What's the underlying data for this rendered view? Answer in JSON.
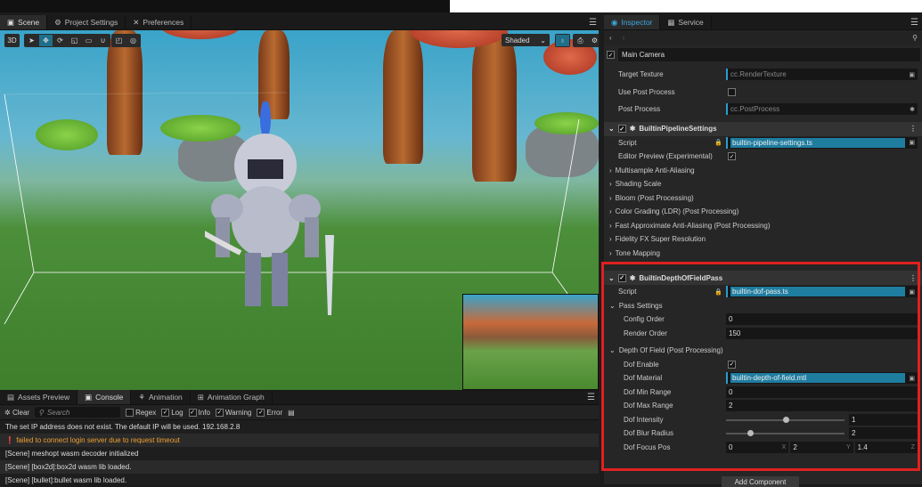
{
  "left_tabs": [
    {
      "label": "Scene",
      "icon": "scene-icon"
    },
    {
      "label": "Project Settings",
      "icon": "gear-icon"
    },
    {
      "label": "Preferences",
      "icon": "tools-icon"
    }
  ],
  "viewport": {
    "mode_3d": "3D",
    "shading": "Shaded"
  },
  "bottom_tabs": [
    {
      "label": "Assets Preview"
    },
    {
      "label": "Console"
    },
    {
      "label": "Animation"
    },
    {
      "label": "Animation Graph"
    }
  ],
  "console": {
    "clear": "Clear",
    "search_placeholder": "Search",
    "filters": [
      {
        "label": "Regex",
        "checked": false
      },
      {
        "label": "Log",
        "checked": true
      },
      {
        "label": "Info",
        "checked": true
      },
      {
        "label": "Warning",
        "checked": true
      },
      {
        "label": "Error",
        "checked": true
      }
    ],
    "logs": [
      {
        "text": "The set IP address does not exist. The default IP will be used. 192.168.2.8",
        "type": "log"
      },
      {
        "text": "failed to connect login server due to request timeout",
        "type": "warn"
      },
      {
        "text": "[Scene] meshopt wasm decoder initialized",
        "type": "log"
      },
      {
        "text": "[Scene] [box2d]:box2d wasm lib loaded.",
        "type": "log"
      },
      {
        "text": "[Scene] [bullet]:bullet wasm lib loaded.",
        "type": "log"
      }
    ]
  },
  "right_tabs": [
    {
      "label": "Inspector"
    },
    {
      "label": "Service"
    }
  ],
  "inspector": {
    "node": "Main Camera",
    "camera": {
      "target_texture_label": "Target Texture",
      "target_texture": "cc.RenderTexture",
      "use_post_label": "Use Post Process",
      "post_process_label": "Post Process",
      "post_process": "cc.PostProcess"
    },
    "pipeline": {
      "title": "BuiltinPipelineSettings",
      "script_label": "Script",
      "script": "builtin-pipeline-settings.ts",
      "editor_preview": "Editor Preview (Experimental)",
      "sections": [
        "Multisample Anti-Aliasing",
        "Shading Scale",
        "Bloom (Post Processing)",
        "Color Grading (LDR) (Post Processing)",
        "Fast Approximate Anti-Aliasing (Post Processing)",
        "Fidelity FX Super Resolution",
        "Tone Mapping"
      ]
    },
    "dof": {
      "title": "BuiltinDepthOfFieldPass",
      "script_label": "Script",
      "script": "builtin-dof-pass.ts",
      "pass_settings": "Pass Settings",
      "config_order_label": "Config Order",
      "config_order": "0",
      "render_order_label": "Render Order",
      "render_order": "150",
      "section": "Depth Of Field (Post Processing)",
      "enable_label": "Dof Enable",
      "material_label": "Dof Material",
      "material": "builtin-depth-of-field.mtl",
      "min_label": "Dof Min Range",
      "min": "0",
      "max_label": "Dof Max Range",
      "max": "2",
      "intensity_label": "Dof Intensity",
      "intensity": "1",
      "intensity_fraction": 0.5,
      "blur_label": "Dof Blur Radius",
      "blur": "2",
      "blur_fraction": 0.2,
      "focus_label": "Dof Focus Pos",
      "focus": {
        "x": "0",
        "y": "2",
        "z": "1.4"
      },
      "axis": {
        "x": "X",
        "y": "Y",
        "z": "Z"
      }
    },
    "add_component": "Add Component"
  }
}
